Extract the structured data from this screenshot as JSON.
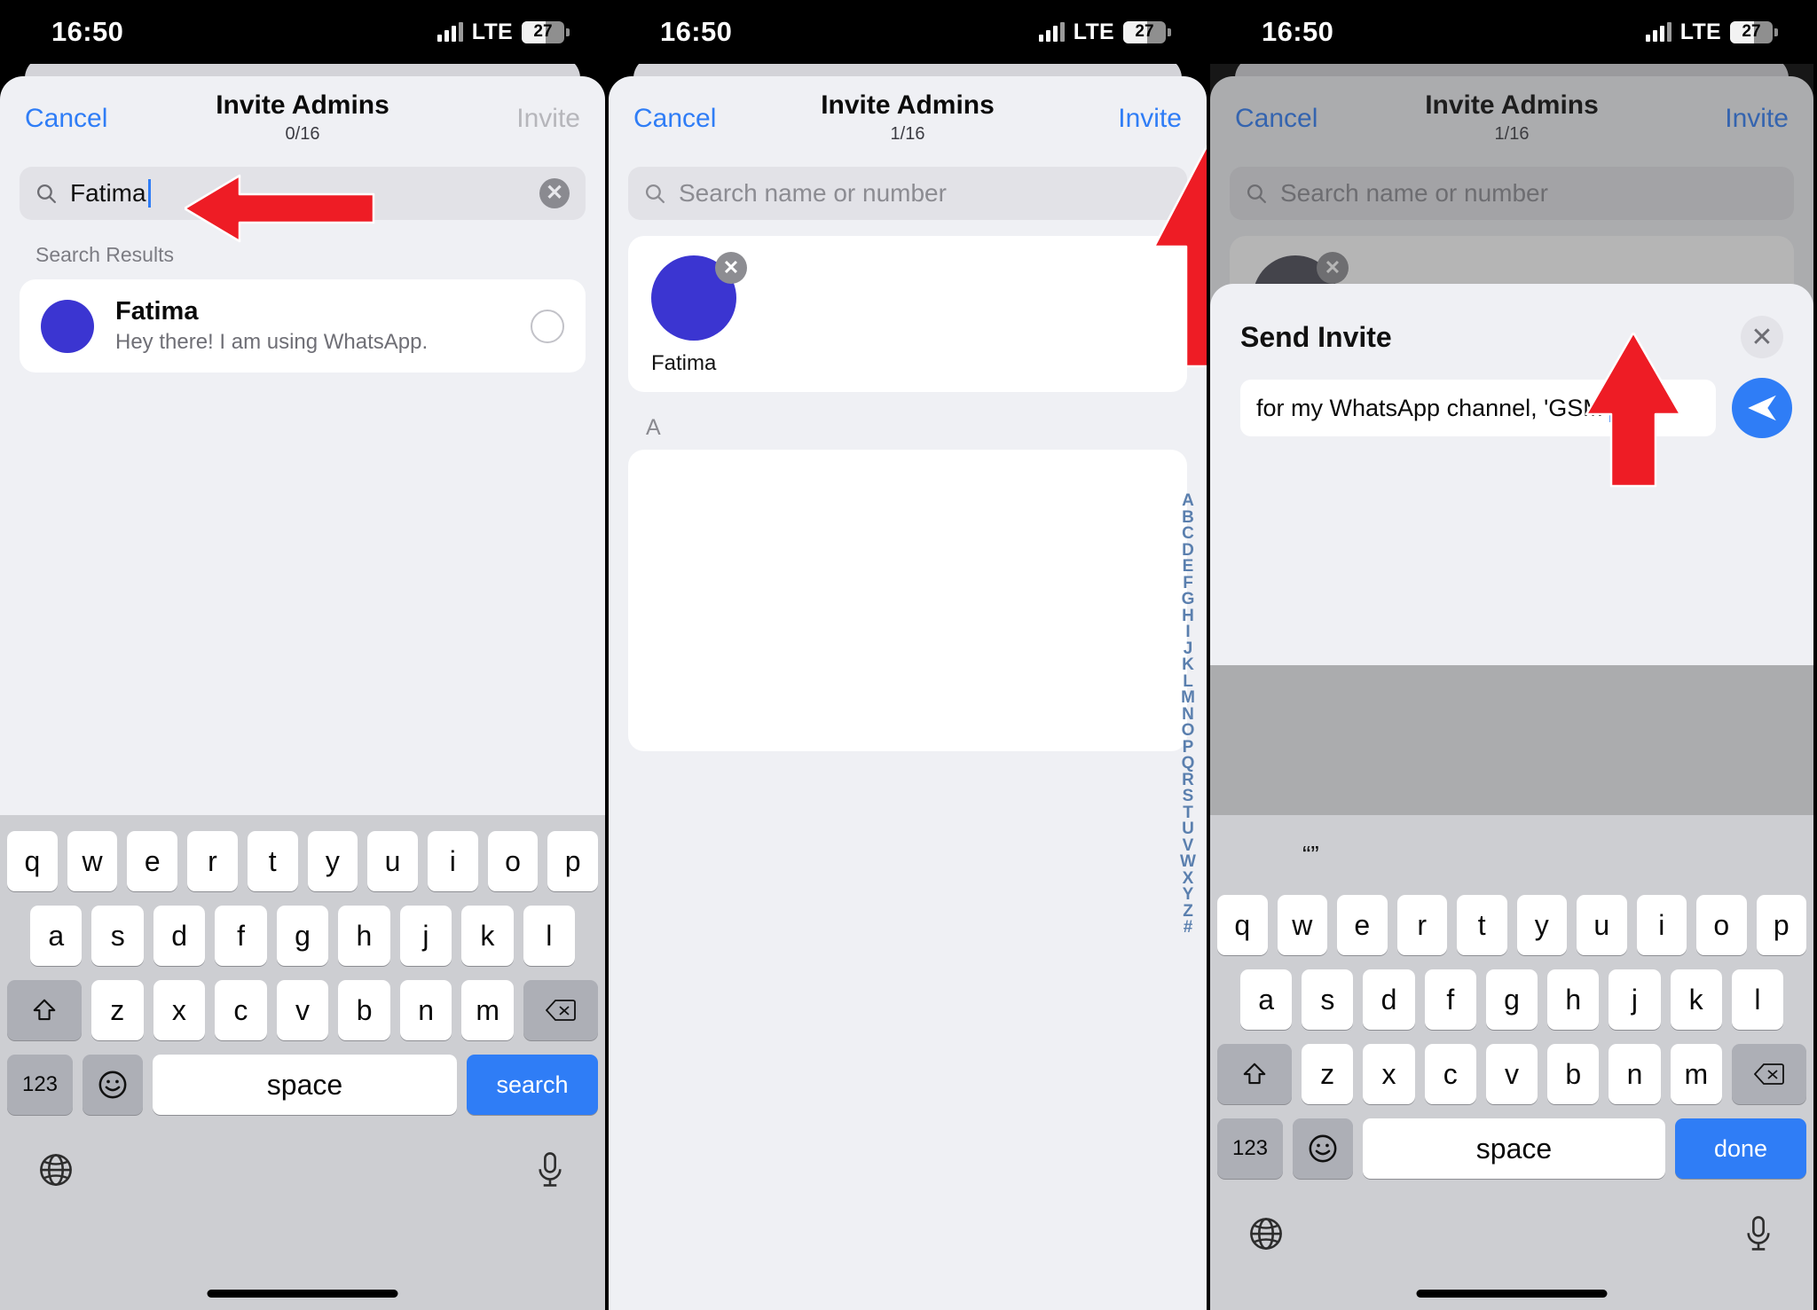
{
  "status_bar": {
    "time": "16:50",
    "network": "LTE",
    "battery": "27"
  },
  "panels": [
    {
      "id": "panel-search",
      "nav": {
        "cancel": "Cancel",
        "title": "Invite Admins",
        "count": "0/16",
        "action": "Invite"
      },
      "search": {
        "value": "Fatima",
        "placeholder": "Search name or number"
      },
      "section_header": "Search Results",
      "results": [
        {
          "name": "Fatima",
          "status": "Hey there! I am using WhatsApp."
        }
      ],
      "keyboard": {
        "row1": [
          "q",
          "w",
          "e",
          "r",
          "t",
          "y",
          "u",
          "i",
          "o",
          "p"
        ],
        "row2": [
          "a",
          "s",
          "d",
          "f",
          "g",
          "h",
          "j",
          "k",
          "l"
        ],
        "row3": [
          "z",
          "x",
          "c",
          "v",
          "b",
          "n",
          "m"
        ],
        "shift": "shift-key",
        "backspace": "backspace-key",
        "numbers": "123",
        "emoji": "emoji-key",
        "space": "space",
        "action": "search",
        "globe": "globe-key",
        "mic": "mic-key"
      }
    },
    {
      "id": "panel-selected",
      "nav": {
        "cancel": "Cancel",
        "title": "Invite Admins",
        "count": "1/16",
        "action": "Invite"
      },
      "search": {
        "value": "",
        "placeholder": "Search name or number"
      },
      "selected": [
        {
          "name": "Fatima",
          "remove": "remove-chip"
        }
      ],
      "alpha_section": "A",
      "alpha_index": [
        "A",
        "B",
        "C",
        "D",
        "E",
        "F",
        "G",
        "H",
        "I",
        "J",
        "K",
        "L",
        "M",
        "N",
        "O",
        "P",
        "Q",
        "R",
        "S",
        "T",
        "U",
        "V",
        "W",
        "X",
        "Y",
        "Z",
        "#"
      ]
    },
    {
      "id": "panel-send-invite",
      "nav": {
        "cancel": "Cancel",
        "title": "Invite Admins",
        "count": "1/16",
        "action": "Invite"
      },
      "search": {
        "value": "",
        "placeholder": "Search name or number"
      },
      "modal": {
        "title": "Send Invite",
        "close": "close-modal",
        "message": "for my WhatsApp channel, 'GSM'",
        "send": "send-invite-button"
      },
      "keyboard": {
        "predictions": [
          "“”",
          "",
          ""
        ],
        "row1": [
          "q",
          "w",
          "e",
          "r",
          "t",
          "y",
          "u",
          "i",
          "o",
          "p"
        ],
        "row2": [
          "a",
          "s",
          "d",
          "f",
          "g",
          "h",
          "j",
          "k",
          "l"
        ],
        "row3": [
          "z",
          "x",
          "c",
          "v",
          "b",
          "n",
          "m"
        ],
        "numbers": "123",
        "emoji": "emoji-key",
        "space": "space",
        "action": "done"
      }
    }
  ],
  "annotations": {
    "arrow_search": "red-arrow-pointing-left-at-search-field",
    "arrow_invite": "red-arrow-pointing-up-at-invite-button",
    "arrow_send": "red-arrow-pointing-up-at-send-button"
  },
  "colors": {
    "accent": "#2f7df6",
    "avatar": "#3b35d1",
    "arrow": "#ee1c25",
    "sheet": "#eff0f4"
  }
}
